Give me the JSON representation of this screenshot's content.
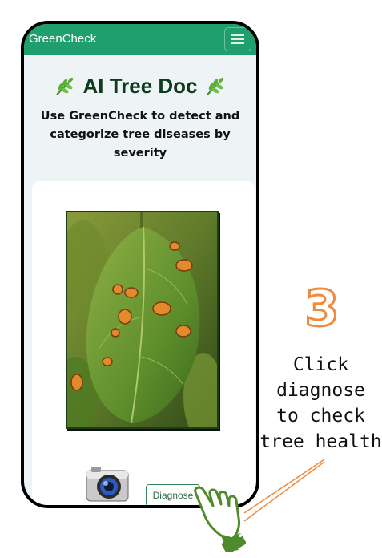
{
  "app": {
    "brand": "GreenCheck",
    "menu_icon": "hamburger-menu-icon",
    "accent_color": "#1f9e6e"
  },
  "hero": {
    "title": "AI Tree Doc",
    "title_icon": "herb-icon",
    "subtitle_line1": "Use GreenCheck to detect and",
    "subtitle_line2": "categorize tree diseases by severity"
  },
  "upload": {
    "camera_icon": "camera-icon",
    "diagnose_label": "Diagnose"
  },
  "tutorial": {
    "step_number": "3",
    "line1": "Click",
    "line2": "diagnose",
    "line3": "to check",
    "line4": "tree health",
    "step_color": "#f08a3c",
    "pointer_icon": "pointing-hand-icon"
  }
}
